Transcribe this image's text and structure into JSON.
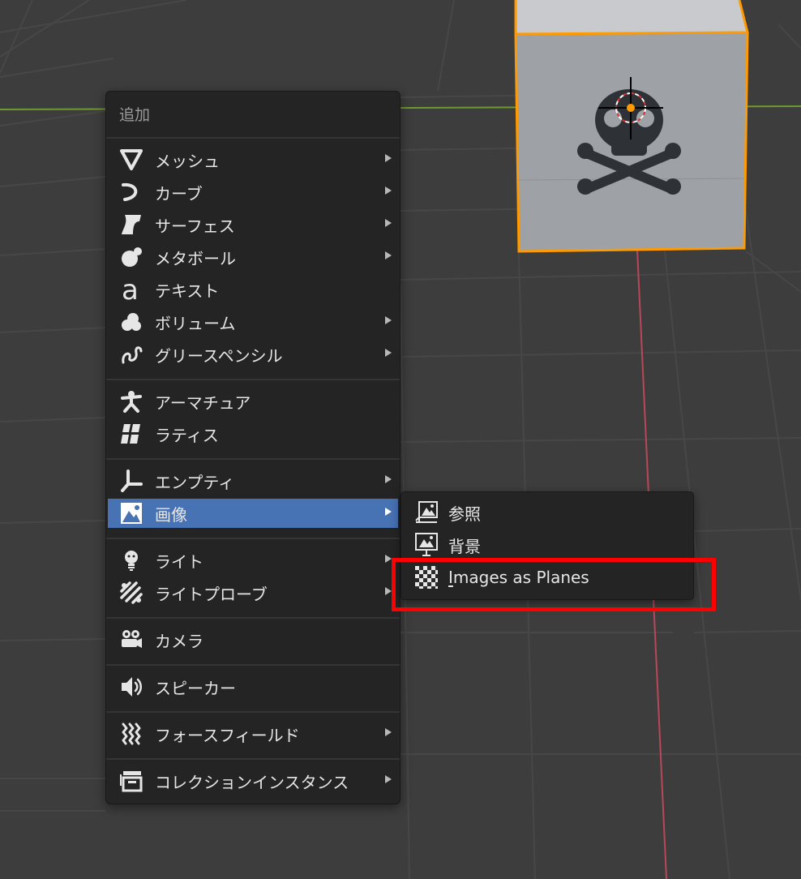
{
  "menu": {
    "title": "追加",
    "items": [
      {
        "label": "メッシュ",
        "icon": "mesh-icon"
      },
      {
        "label": "カーブ",
        "icon": "curve-icon"
      },
      {
        "label": "サーフェス",
        "icon": "surface-icon"
      },
      {
        "label": "メタボール",
        "icon": "metaball-icon"
      },
      {
        "label": "テキスト",
        "icon": "text-icon"
      },
      {
        "label": "ボリューム",
        "icon": "volume-icon"
      },
      {
        "label": "グリースペンシル",
        "icon": "grease-pencil-icon"
      },
      {
        "label": "アーマチュア",
        "icon": "armature-icon"
      },
      {
        "label": "ラティス",
        "icon": "lattice-icon"
      },
      {
        "label": "エンプティ",
        "icon": "empty-icon"
      },
      {
        "label": "画像",
        "icon": "image-icon"
      },
      {
        "label": "ライト",
        "icon": "light-icon"
      },
      {
        "label": "ライトプローブ",
        "icon": "light-probe-icon"
      },
      {
        "label": "カメラ",
        "icon": "camera-icon"
      },
      {
        "label": "スピーカー",
        "icon": "speaker-icon"
      },
      {
        "label": "フォースフィールド",
        "icon": "force-field-icon"
      },
      {
        "label": "コレクションインスタンス",
        "icon": "collection-instance-icon"
      }
    ]
  },
  "submenu": {
    "items": [
      {
        "label": "参照",
        "icon": "image-reference-icon"
      },
      {
        "label": "背景",
        "icon": "image-background-icon"
      },
      {
        "label_mnemonic": "I",
        "label_rest": "mages as Planes",
        "icon": "checkerboard-icon"
      }
    ]
  },
  "colors": {
    "viewport_bg": "#3d3d3d",
    "menu_bg": "#242424",
    "active_item": "#4772b3",
    "object_outline": "#ff9a00",
    "highlight_box": "#ff0000"
  }
}
